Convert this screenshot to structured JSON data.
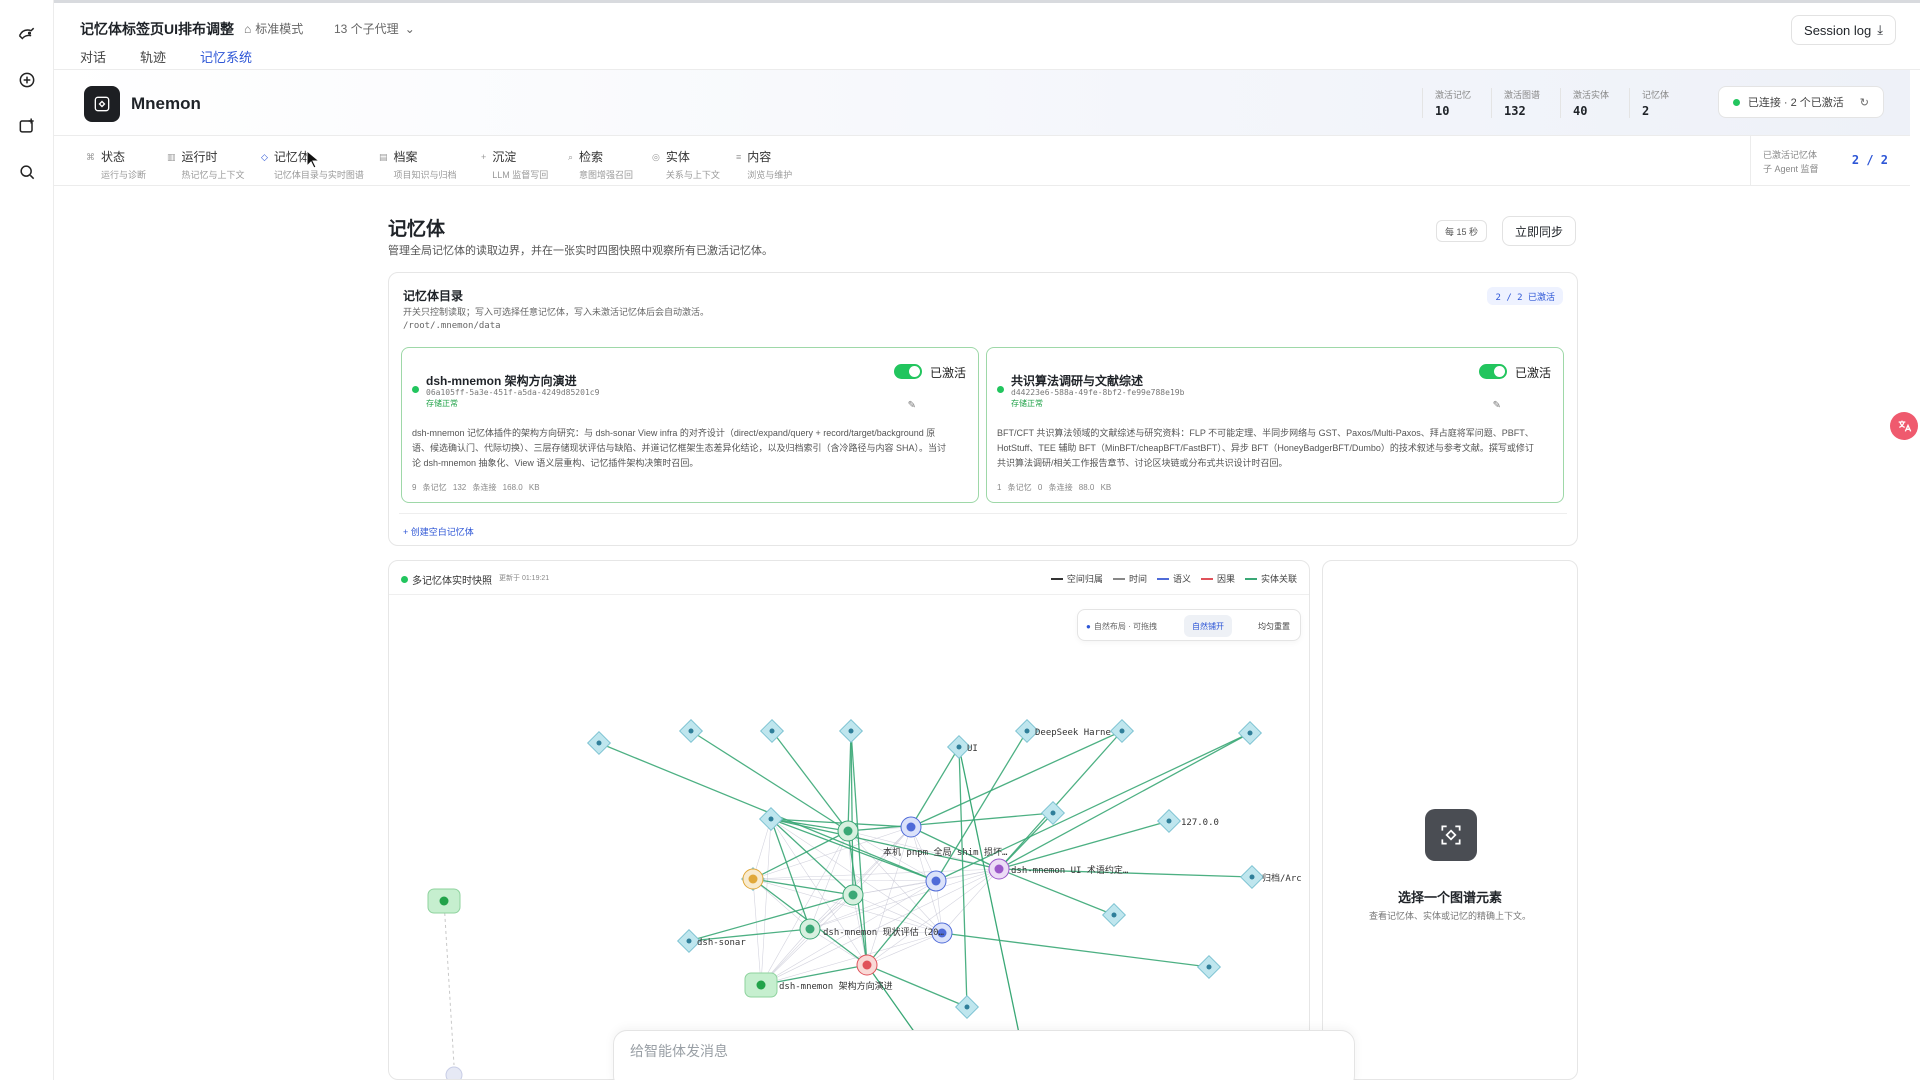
{
  "session": {
    "title": "记忆体标签页UI排布调整",
    "mode": "标准模式",
    "agents": "13 个子代理"
  },
  "main_tabs": [
    {
      "label": "对话",
      "active": false
    },
    {
      "label": "轨迹",
      "active": false
    },
    {
      "label": "记忆系统",
      "active": true
    }
  ],
  "session_log": "Session log",
  "app": {
    "name": "Mnemon"
  },
  "stats": [
    {
      "label": "激活记忆",
      "value": "10"
    },
    {
      "label": "激活图谱",
      "value": "132"
    },
    {
      "label": "激活实体",
      "value": "40"
    },
    {
      "label": "记忆体",
      "value": "2"
    }
  ],
  "connection": "已连接 · 2 个已激活",
  "subtabs": [
    {
      "icon": "⌘",
      "title": "状态",
      "desc": "运行与诊断"
    },
    {
      "icon": "▥",
      "title": "运行时",
      "desc": "热记忆与上下文"
    },
    {
      "icon": "◇",
      "title": "记忆体",
      "desc": "记忆体目录与实时图谱"
    },
    {
      "icon": "▤",
      "title": "档案",
      "desc": "项目知识与归档"
    },
    {
      "icon": "+",
      "title": "沉淀",
      "desc": "LLM 监督写回"
    },
    {
      "icon": "⌕",
      "title": "检索",
      "desc": "意图增强召回"
    },
    {
      "icon": "◎",
      "title": "实体",
      "desc": "关系与上下文"
    },
    {
      "icon": "≡",
      "title": "内容",
      "desc": "浏览与维护"
    }
  ],
  "activated_box": {
    "line1": "已激活记忆体",
    "line2": "子 Agent 监督",
    "value": "2 / 2"
  },
  "page": {
    "title": "记忆体",
    "desc": "管理全局记忆体的读取边界，并在一张实时四图快照中观察所有已激活记忆体。",
    "interval": "每 15 秒",
    "sync": "立即同步"
  },
  "directory": {
    "title": "记忆体目录",
    "desc": "开关只控制读取；写入可选择任意记忆体，写入未激活记忆体后会自动激活。",
    "path": "/root/.mnemon/data",
    "badge": "2 / 2 已激活",
    "create": "+ 创建空白记忆体",
    "cards": [
      {
        "title": "dsh-mnemon 架构方向演进",
        "id": "06a105ff-5a3e-451f-a5da-4249d85201c9",
        "state": "存储正常",
        "toggle": "已激活",
        "desc": "dsh-mnemon 记忆体插件的架构方向研究：与 dsh-sonar View infra 的对齐设计（direct/expand/query + record/target/background 原语、候选确认门、代际切换）、三层存储现状评估与缺陷、并道记忆框架生态差异化结论，以及归档索引（含冷路径与内容 SHA）。当讨论 dsh-mnemon 抽象化、View 语义层重构、记忆插件架构决策时召回。",
        "meta": "9 条记忆 132 条连接 168.0 KB"
      },
      {
        "title": "共识算法调研与文献综述",
        "id": "d44223e6-588a-49fe-8bf2-fe99e788e19b",
        "state": "存储正常",
        "toggle": "已激活",
        "desc": "BFT/CFT 共识算法领域的文献综述与研究资料：FLP 不可能定理、半同步网络与 GST、Paxos/Multi-Paxos、拜占庭将军问题、PBFT、HotStuff、TEE 辅助 BFT（MinBFT/cheapBFT/FastBFT）、异步 BFT（HoneyBadgerBFT/Dumbo）的技术叙述与参考文献。撰写或修订共识算法调研/相关工作报告章节、讨论区块链或分布式共识设计时召回。",
        "meta": "1 条记忆 0 条连接 88.0 KB"
      }
    ]
  },
  "graph": {
    "title": "多记忆体实时快照",
    "updated": "更新于 01:19:21",
    "legend": [
      {
        "label": "空间归属",
        "color": "#333333",
        "dash": true
      },
      {
        "label": "时间",
        "color": "#888888",
        "dash": false
      },
      {
        "label": "语义",
        "color": "#4f6bd8",
        "dash": false
      },
      {
        "label": "因果",
        "color": "#e0525a",
        "dash": false
      },
      {
        "label": "实体关联",
        "color": "#3aa876",
        "dash": false
      }
    ],
    "layout": {
      "hint": "自然布局 · 可拖拽",
      "active": "自然铺开",
      "reset": "均匀重置"
    },
    "labels": {
      "ui": "UI",
      "deepseek": "DeepSeek Harne",
      "local_pnpm": "本机 pnpm 全局 shim 损坏…",
      "ip": "127.0.0",
      "dsh_ui": "dsh-mnemon UI 术语约定…",
      "archive": "归档/Arc",
      "sonar": "dsh-sonar",
      "status_eval": "dsh-mnemon 现状评估（20…",
      "arch_dir": "dsh-mnemon 架构方向演进"
    }
  },
  "detail": {
    "title": "选择一个图谱元素",
    "desc": "查看记忆体、实体或记忆的精确上下文。"
  },
  "composer": {
    "placeholder": "给智能体发消息"
  },
  "colors": {
    "accent": "#2d56d6",
    "active_green": "#22c55e",
    "edge_entity": "#3aa876",
    "entity_node": "#bfe6ee"
  }
}
